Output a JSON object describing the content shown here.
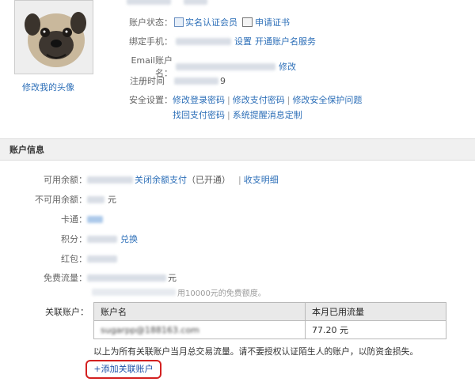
{
  "profile": {
    "avatar_caption": "修改我的头像",
    "rows": {
      "status": {
        "label": "账户状态：",
        "realname": "实名认证会员",
        "cert": "申请证书"
      },
      "phone": {
        "label": "绑定手机：",
        "set": "设置",
        "service": "开通账户名服务"
      },
      "email": {
        "label": "Email账户名：",
        "edit": "修改"
      },
      "regtime": {
        "label": "注册时间",
        "tail": "9"
      },
      "security": {
        "label": "安全设置：",
        "links1": [
          "修改登录密码",
          "修改支付密码",
          "修改安全保护问题"
        ],
        "links2": [
          "找回支付密码",
          "系统提醒消息定制"
        ]
      }
    }
  },
  "account": {
    "section_title": "账户信息",
    "balance": {
      "label": "可用余额：",
      "toggle": "关闭余额支付",
      "status": "（已开通）",
      "detail": "收支明细"
    },
    "unavailable": {
      "label": "不可用余额：",
      "unit": "元"
    },
    "card": {
      "label": "卡通："
    },
    "points": {
      "label": "积分：",
      "redeem": "兑换"
    },
    "redpacket": {
      "label": "红包："
    },
    "traffic": {
      "label": "免费流量：",
      "unit": "元",
      "note_tail": "用10000元的免费额度。"
    },
    "linked": {
      "label": "关联账户：",
      "headers": [
        "账户名",
        "本月已用流量"
      ],
      "rows": [
        {
          "name": "sugarpp@188163.com",
          "used": "77.20 元"
        }
      ],
      "note": "以上为所有关联账户当月总交易流量。请不要授权认证陌生人的账户，以防资金损失。",
      "add_button": "+添加关联账户"
    }
  }
}
